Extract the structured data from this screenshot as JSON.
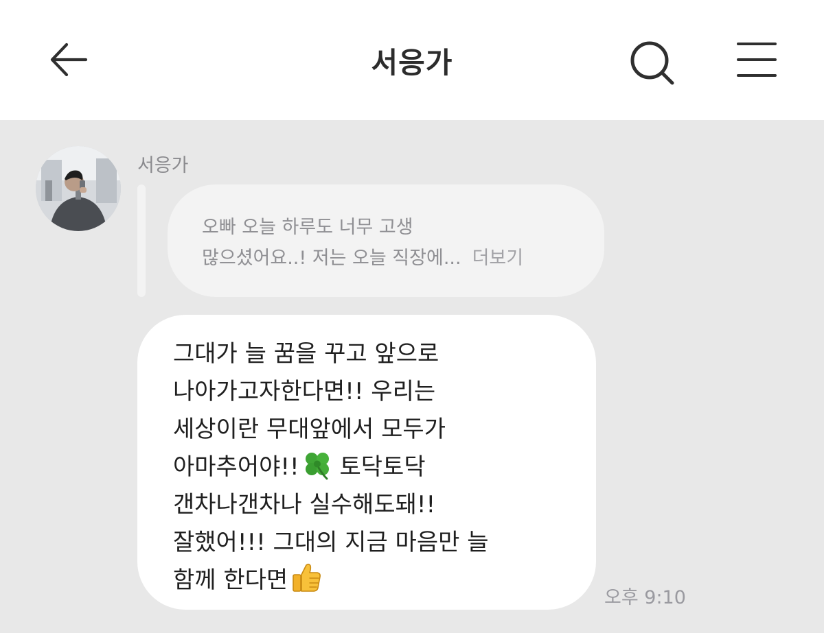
{
  "header": {
    "title": "서응가",
    "back_icon": "arrow-left-icon",
    "search_icon": "search-icon",
    "menu_icon": "hamburger-menu-icon"
  },
  "message": {
    "sender": "서응가",
    "reply_preview": {
      "line1": "오빠 오늘 하루도 너무 고생",
      "line2": "많으셨어요..! 저는 오늘 직장에...",
      "more": "더보기"
    },
    "body_lines": [
      "그대가 늘 꿈을 꾸고 앞으로",
      "나아가고자한다면!! 우리는",
      "세상이란 무대앞에서 모두가",
      "아마추어야!!",
      "토닥토닥",
      "갠차나갠차나 실수해도돼!!",
      "잘했어!!! 그대의 지금 마음만 늘",
      "함께 한다면"
    ],
    "emojis": [
      "four-leaf-clover-icon",
      "thumbs-up-icon"
    ],
    "time": "오후 9:10"
  }
}
